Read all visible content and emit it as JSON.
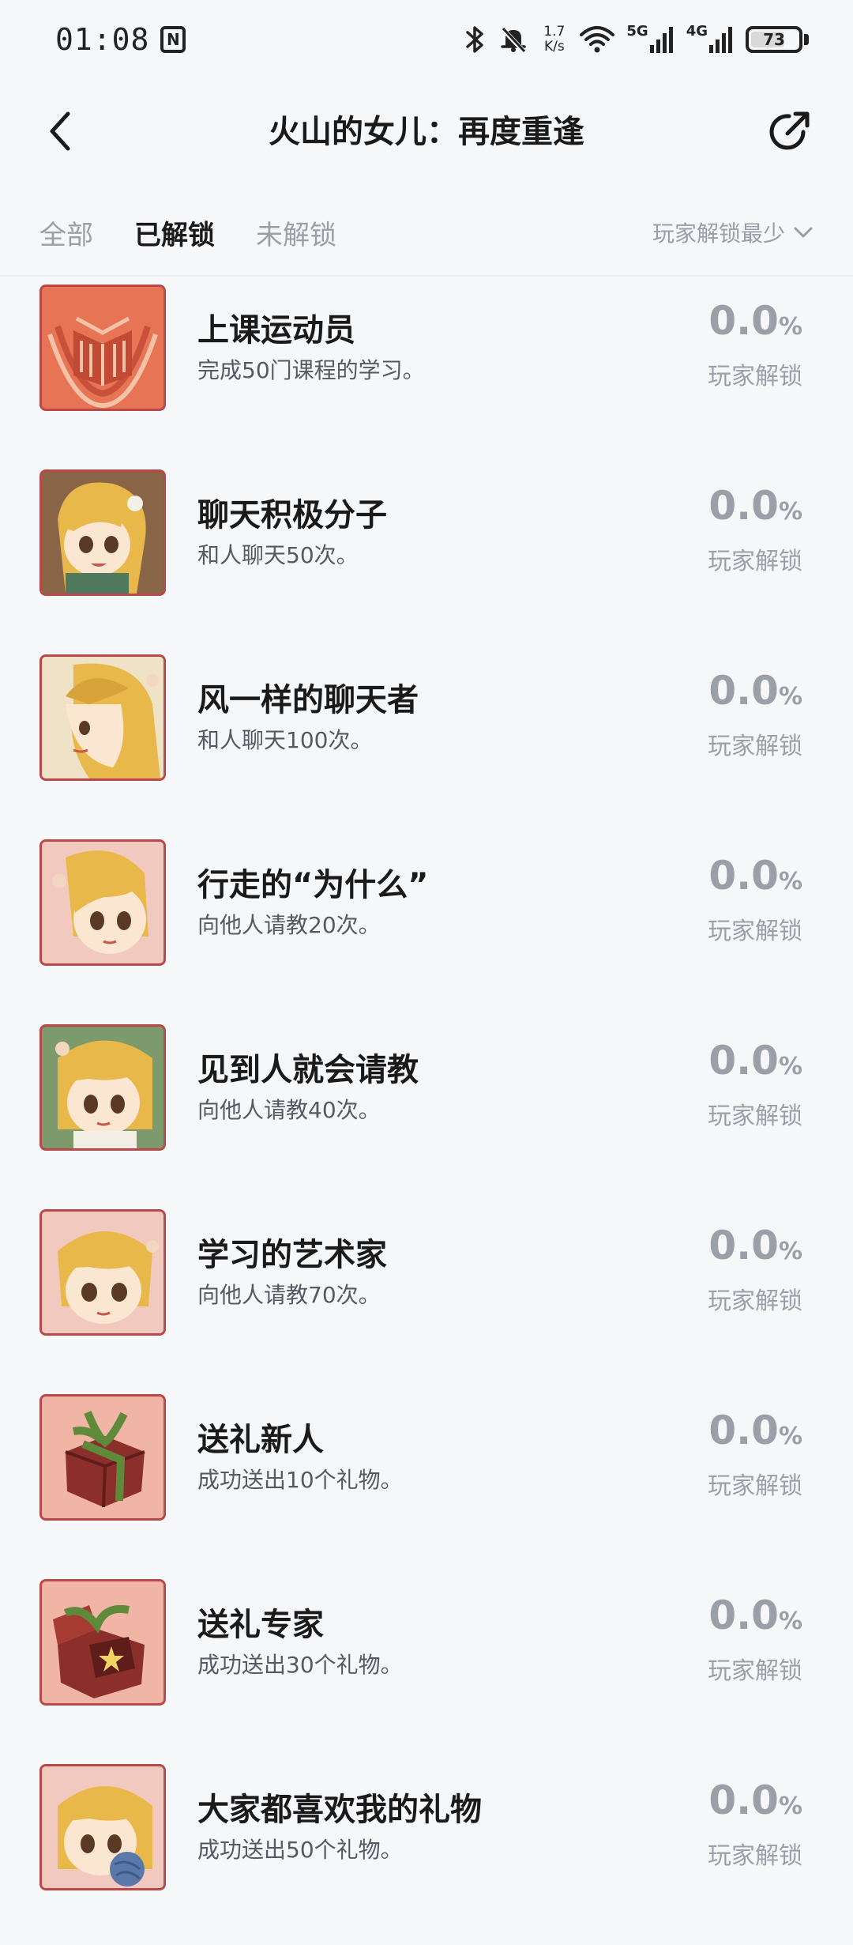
{
  "status_bar": {
    "time": "01:08",
    "nfc_label": "N",
    "speed_value": "1.7",
    "speed_unit": "K/s",
    "net1_label": "5G",
    "net2_label": "4G",
    "battery_level": "73"
  },
  "header": {
    "title": "火山的女儿：再度重逢"
  },
  "tabs": [
    {
      "label": "全部"
    },
    {
      "label": "已解锁"
    },
    {
      "label": "未解锁"
    }
  ],
  "sort": {
    "label": "玩家解锁最少"
  },
  "achievements": [
    {
      "title": "上课运动员",
      "desc": "完成50门课程的学习。",
      "percent": "0.0",
      "pct_sign": "%",
      "rate_label": "玩家解锁",
      "icon": "book-badge-icon"
    },
    {
      "title": "聊天积极分子",
      "desc": "和人聊天50次。",
      "percent": "0.0",
      "pct_sign": "%",
      "rate_label": "玩家解锁",
      "icon": "girl-portrait-icon"
    },
    {
      "title": "风一样的聊天者",
      "desc": "和人聊天100次。",
      "percent": "0.0",
      "pct_sign": "%",
      "rate_label": "玩家解锁",
      "icon": "girl-portrait-icon"
    },
    {
      "title": "行走的“为什么”",
      "desc": "向他人请教20次。",
      "percent": "0.0",
      "pct_sign": "%",
      "rate_label": "玩家解锁",
      "icon": "girl-portrait-icon"
    },
    {
      "title": "见到人就会请教",
      "desc": "向他人请教40次。",
      "percent": "0.0",
      "pct_sign": "%",
      "rate_label": "玩家解锁",
      "icon": "girl-portrait-icon"
    },
    {
      "title": "学习的艺术家",
      "desc": "向他人请教70次。",
      "percent": "0.0",
      "pct_sign": "%",
      "rate_label": "玩家解锁",
      "icon": "girl-portrait-icon"
    },
    {
      "title": "送礼新人",
      "desc": "成功送出10个礼物。",
      "percent": "0.0",
      "pct_sign": "%",
      "rate_label": "玩家解锁",
      "icon": "gift-box-icon"
    },
    {
      "title": "送礼专家",
      "desc": "成功送出30个礼物。",
      "percent": "0.0",
      "pct_sign": "%",
      "rate_label": "玩家解锁",
      "icon": "open-gift-icon"
    },
    {
      "title": "大家都喜欢我的礼物",
      "desc": "成功送出50个礼物。",
      "percent": "0.0",
      "pct_sign": "%",
      "rate_label": "玩家解锁",
      "icon": "girl-portrait-icon"
    }
  ]
}
